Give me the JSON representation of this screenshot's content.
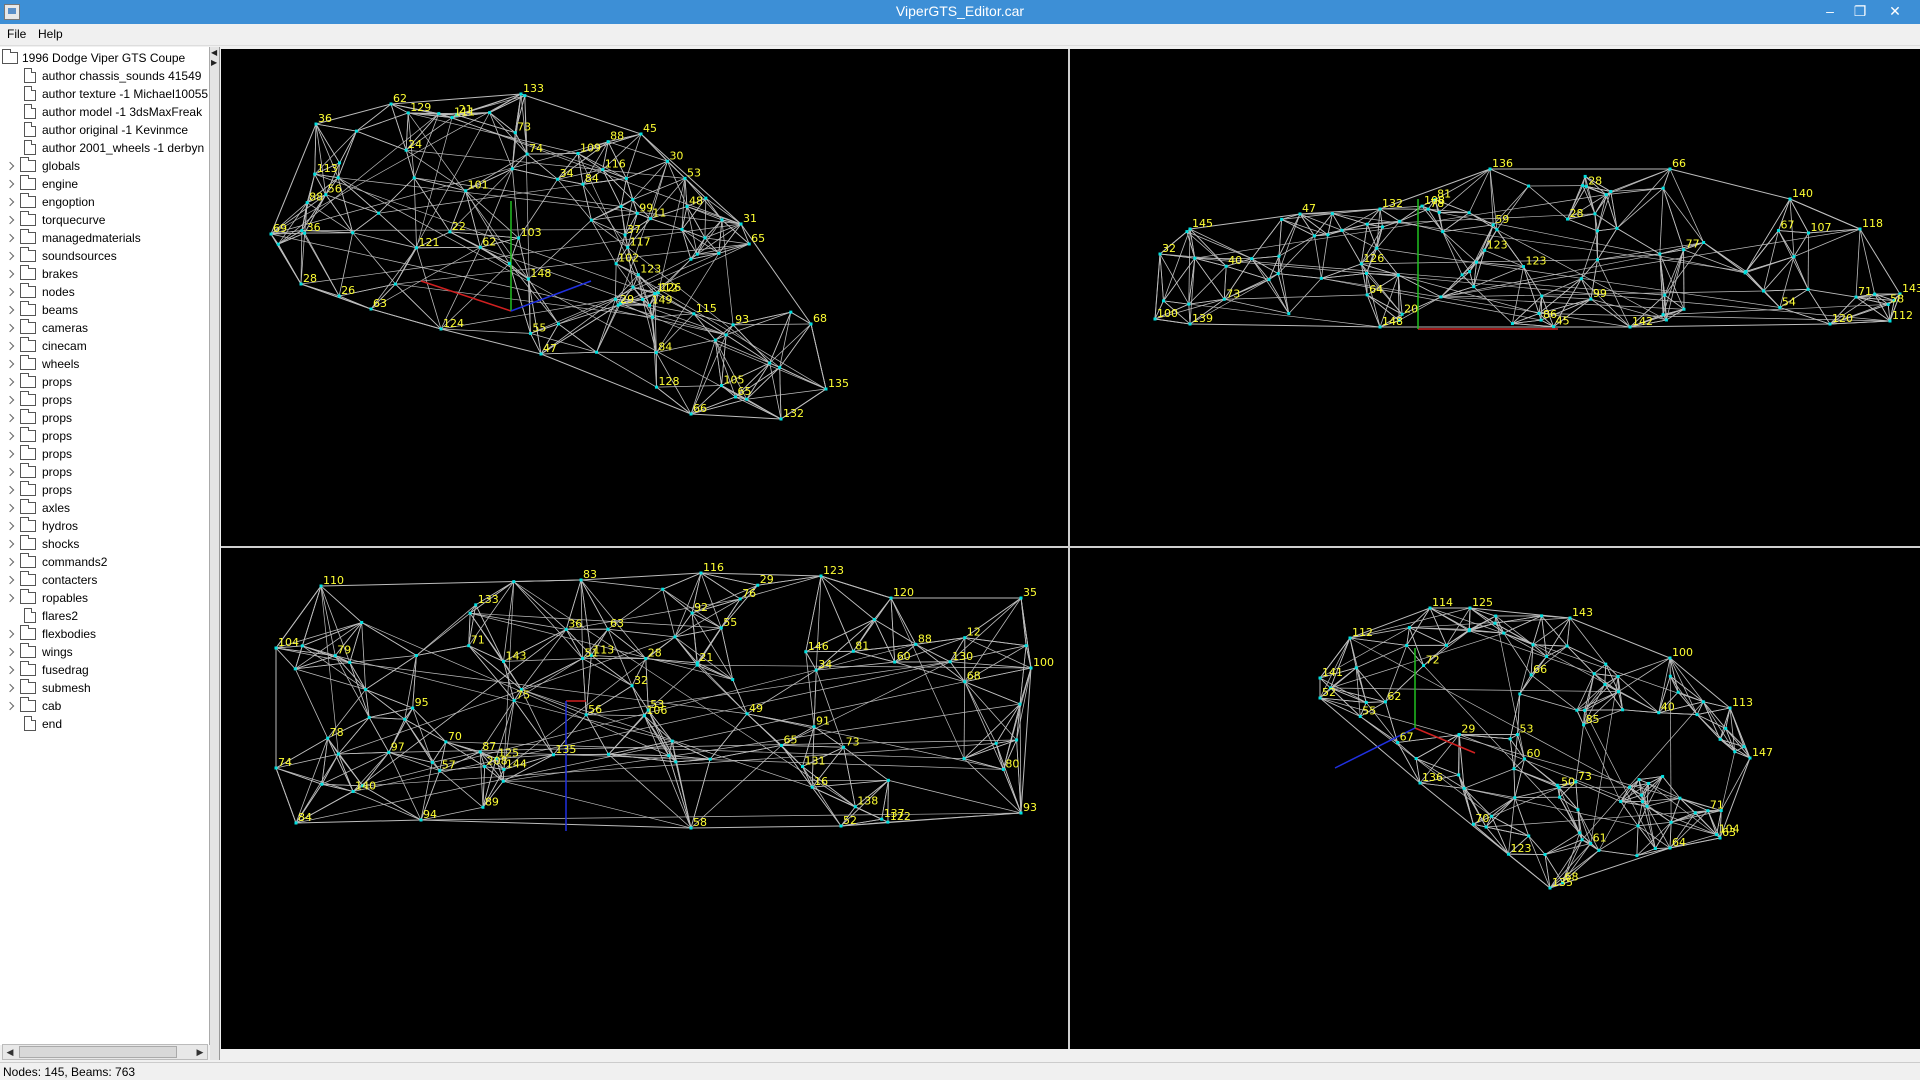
{
  "window": {
    "title": "ViperGTS_Editor.car",
    "minimize_glyph": "–",
    "restore_glyph": "❐",
    "close_glyph": "✕"
  },
  "menu": {
    "items": [
      "File",
      "Help"
    ]
  },
  "tree": {
    "root": "1996 Dodge Viper GTS Coupe",
    "authors": [
      "author chassis_sounds 41549",
      "author texture -1 Michael10055",
      "author model -1 3dsMaxFreak",
      "author original -1 Kevinmce",
      "author 2001_wheels -1 derbyn"
    ],
    "sections": [
      {
        "label": "globals",
        "kind": "folder"
      },
      {
        "label": "engine",
        "kind": "folder"
      },
      {
        "label": "engoption",
        "kind": "folder"
      },
      {
        "label": "torquecurve",
        "kind": "folder"
      },
      {
        "label": "managedmaterials",
        "kind": "folder"
      },
      {
        "label": "soundsources",
        "kind": "folder"
      },
      {
        "label": "brakes",
        "kind": "folder"
      },
      {
        "label": "nodes",
        "kind": "folder"
      },
      {
        "label": "beams",
        "kind": "folder"
      },
      {
        "label": "cameras",
        "kind": "folder"
      },
      {
        "label": "cinecam",
        "kind": "folder"
      },
      {
        "label": "wheels",
        "kind": "folder"
      },
      {
        "label": "props",
        "kind": "folder"
      },
      {
        "label": "props",
        "kind": "folder"
      },
      {
        "label": "props",
        "kind": "folder"
      },
      {
        "label": "props",
        "kind": "folder"
      },
      {
        "label": "props",
        "kind": "folder"
      },
      {
        "label": "props",
        "kind": "folder"
      },
      {
        "label": "props",
        "kind": "folder"
      },
      {
        "label": "axles",
        "kind": "folder"
      },
      {
        "label": "hydros",
        "kind": "folder"
      },
      {
        "label": "shocks",
        "kind": "folder"
      },
      {
        "label": "commands2",
        "kind": "folder"
      },
      {
        "label": "contacters",
        "kind": "folder"
      },
      {
        "label": "ropables",
        "kind": "folder"
      },
      {
        "label": "flares2",
        "kind": "file"
      },
      {
        "label": "flexbodies",
        "kind": "folder"
      },
      {
        "label": "wings",
        "kind": "folder"
      },
      {
        "label": "fusedrag",
        "kind": "folder"
      },
      {
        "label": "submesh",
        "kind": "folder"
      },
      {
        "label": "cab",
        "kind": "folder"
      },
      {
        "label": "end",
        "kind": "file"
      }
    ]
  },
  "viewports": [
    {
      "name": "viewport-perspective-top-left",
      "labels": [
        "69",
        "36",
        "62",
        "133",
        "45",
        "31",
        "68",
        "135",
        "132",
        "66",
        "47",
        "124",
        "63",
        "28",
        "30",
        "48",
        "24",
        "121",
        "84",
        "36",
        "115",
        "65",
        "111",
        "55",
        "109",
        "105",
        "103",
        "101",
        "102",
        "99",
        "26",
        "21",
        "65",
        "74",
        "73",
        "84",
        "88",
        "128",
        "62",
        "56",
        "117",
        "149",
        "123",
        "29",
        "93",
        "113",
        "116",
        "129",
        "22",
        "112",
        "34",
        "148",
        "126",
        "11",
        "88",
        "37",
        "53"
      ],
      "wire_color": "#bdbdbd",
      "label_color": "#ffff33",
      "node_color": "#00e0e0"
    },
    {
      "name": "viewport-side-top-right",
      "labels": [
        "32",
        "145",
        "47",
        "132",
        "136",
        "66",
        "140",
        "118",
        "143",
        "112",
        "120",
        "142",
        "148",
        "139",
        "100",
        "73",
        "77",
        "71",
        "78",
        "126",
        "58",
        "59",
        "20",
        "28",
        "86",
        "64",
        "28",
        "40",
        "45",
        "99",
        "123",
        "123",
        "67",
        "81",
        "54",
        "107",
        "108"
      ],
      "wire_color": "#bdbdbd",
      "label_color": "#ffff33",
      "node_color": "#00e0e0"
    },
    {
      "name": "viewport-top-bottom-left",
      "labels": [
        "104",
        "110",
        "83",
        "116",
        "123",
        "120",
        "35",
        "100",
        "93",
        "52",
        "58",
        "94",
        "84",
        "74",
        "32",
        "65",
        "79",
        "28",
        "125",
        "89",
        "88",
        "68",
        "80",
        "87",
        "16",
        "140",
        "208",
        "29",
        "133",
        "49",
        "56",
        "60",
        "135",
        "70",
        "63",
        "92",
        "113",
        "131",
        "130",
        "71",
        "146",
        "143",
        "36",
        "137",
        "73",
        "144",
        "78",
        "138",
        "21",
        "91",
        "97",
        "95",
        "51",
        "53",
        "55",
        "76",
        "75",
        "81",
        "106",
        "34",
        "12",
        "122",
        "57"
      ],
      "wire_color": "#bdbdbd",
      "label_color": "#ffff33",
      "node_color": "#00e0e0"
    },
    {
      "name": "viewport-perspective-bottom-right",
      "labels": [
        "141",
        "112",
        "114",
        "125",
        "143",
        "100",
        "113",
        "147",
        "63",
        "64",
        "135",
        "136",
        "52",
        "61",
        "85",
        "68",
        "72",
        "73",
        "71",
        "67",
        "66",
        "55",
        "53",
        "50",
        "62",
        "70",
        "60",
        "104",
        "29",
        "123",
        "40"
      ],
      "wire_color": "#bdbdbd",
      "label_color": "#ffff33",
      "node_color": "#00e0e0"
    }
  ],
  "axis_colors": {
    "x": "#d02020",
    "y": "#20c020",
    "z": "#2030e0"
  },
  "status": {
    "text": "Nodes: 145, Beams: 763"
  }
}
